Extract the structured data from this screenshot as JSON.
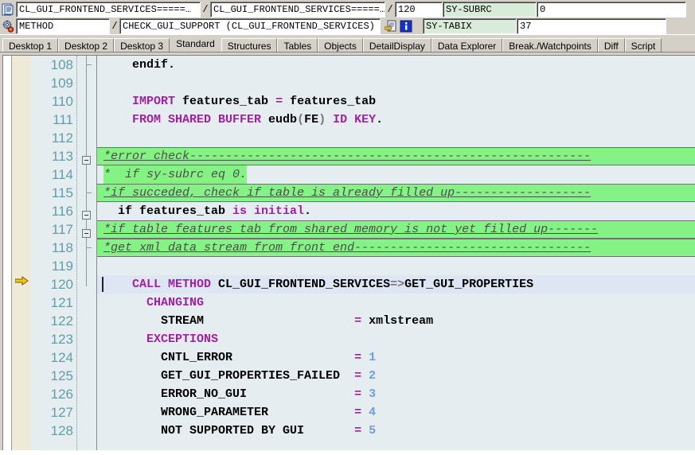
{
  "header": {
    "program_icon": "program-icon",
    "event_icon": "event-gear-icon",
    "program_main": "CL_GUI_FRONTEND_SERVICES=====…",
    "program_include": "CL_GUI_FRONTEND_SERVICES=====…",
    "separator": "/",
    "line_number": "120",
    "event_type": "METHOD",
    "event_name": "CHECK_GUI_SUPPORT (CL_GUI_FRONTEND_SERVICES)",
    "jump_icon": "jump-to-source-icon",
    "info_icon": "information-icon",
    "sysfields": [
      {
        "label": "SY-SUBRC",
        "value": "0"
      },
      {
        "label": "SY-TABIX",
        "value": "37"
      }
    ]
  },
  "tabs": [
    {
      "label": "Desktop 1",
      "active": false
    },
    {
      "label": "Desktop 2",
      "active": false
    },
    {
      "label": "Desktop 3",
      "active": false
    },
    {
      "label": "Standard",
      "active": true
    },
    {
      "label": "Structures",
      "active": false
    },
    {
      "label": "Tables",
      "active": false
    },
    {
      "label": "Objects",
      "active": false
    },
    {
      "label": "DetailDisplay",
      "active": false
    },
    {
      "label": "Data Explorer",
      "active": false
    },
    {
      "label": "Break./Watchpoints",
      "active": false
    },
    {
      "label": "Diff",
      "active": false
    },
    {
      "label": "Script",
      "active": false
    }
  ],
  "editor": {
    "current_line": "120",
    "lines": [
      {
        "no": "108",
        "text": "    endif."
      },
      {
        "no": "109",
        "text": ""
      },
      {
        "no": "110",
        "text": "    IMPORT features_tab = features_tab"
      },
      {
        "no": "111",
        "text": "    FROM SHARED BUFFER eudb(FE) ID KEY."
      },
      {
        "no": "112",
        "text": ""
      },
      {
        "no": "113",
        "text": "*error check--------------------------------------------------------"
      },
      {
        "no": "114",
        "text": "*  if sy-subrc eq 0."
      },
      {
        "no": "115",
        "text": "*if succeded, check if table is already filled up-------------------"
      },
      {
        "no": "116",
        "text": "  if features_tab is initial."
      },
      {
        "no": "117",
        "text": "*if table features_tab from shared memory is not yet filled up-------"
      },
      {
        "no": "118",
        "text": "*get xml data stream from front end---------------------------------"
      },
      {
        "no": "119",
        "text": ""
      },
      {
        "no": "120",
        "text": "    CALL METHOD CL_GUI_FRONTEND_SERVICES=>GET_GUI_PROPERTIES"
      },
      {
        "no": "121",
        "text": "      CHANGING"
      },
      {
        "no": "122",
        "text": "        STREAM                     = xmlstream"
      },
      {
        "no": "123",
        "text": "      EXCEPTIONS"
      },
      {
        "no": "124",
        "text": "        CNTL_ERROR                 = 1"
      },
      {
        "no": "125",
        "text": "        GET_GUI_PROPERTIES_FAILED  = 2"
      },
      {
        "no": "126",
        "text": "        ERROR_NO_GUI               = 3"
      },
      {
        "no": "127",
        "text": "        WRONG_PARAMETER            = 4"
      },
      {
        "no": "128",
        "text": "        NOT SUPPORTED BY GUI       = 5"
      }
    ]
  },
  "colors": {
    "keyword": "#a020a0",
    "identifier": "#000000",
    "number": "#6f9fd8",
    "comment_bg": "#85f285",
    "comment_text": "#4d4d4d",
    "editor_bg": "#e6edf0",
    "current_line_bg": "#dde6f2",
    "line_number": "#5f9ea8",
    "chrome": "#d4d0c8",
    "sysfield_bg": "#d9ecd9"
  }
}
